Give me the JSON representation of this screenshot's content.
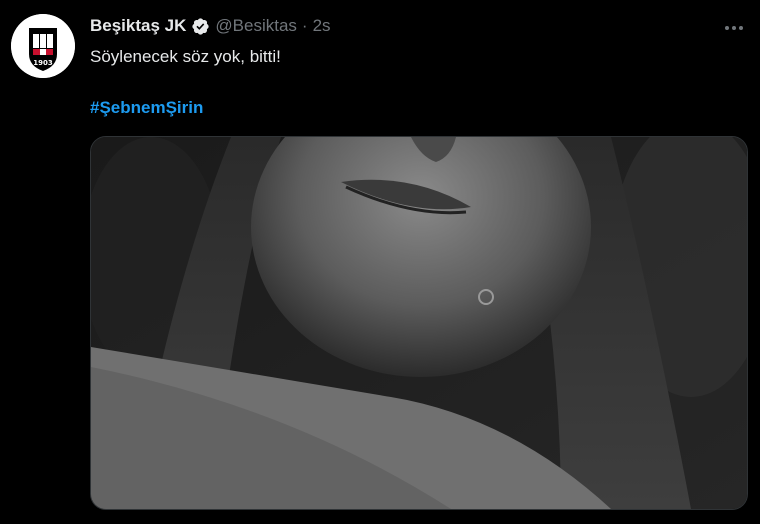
{
  "tweet": {
    "author_name": "Beşiktaş JK",
    "handle": "@Besiktas",
    "separator": "·",
    "time": "2s",
    "text": "Söylenecek söz yok, bitti!",
    "hashtag": "#ŞebnemŞirin"
  },
  "icons": {
    "verified": "verified-badge-icon",
    "more": "more-options-icon",
    "avatar": "besiktas-crest-logo"
  },
  "colors": {
    "background": "#000000",
    "text": "#e7e9ea",
    "muted": "#71767b",
    "link": "#1d9bf0",
    "border": "#2f3336"
  }
}
